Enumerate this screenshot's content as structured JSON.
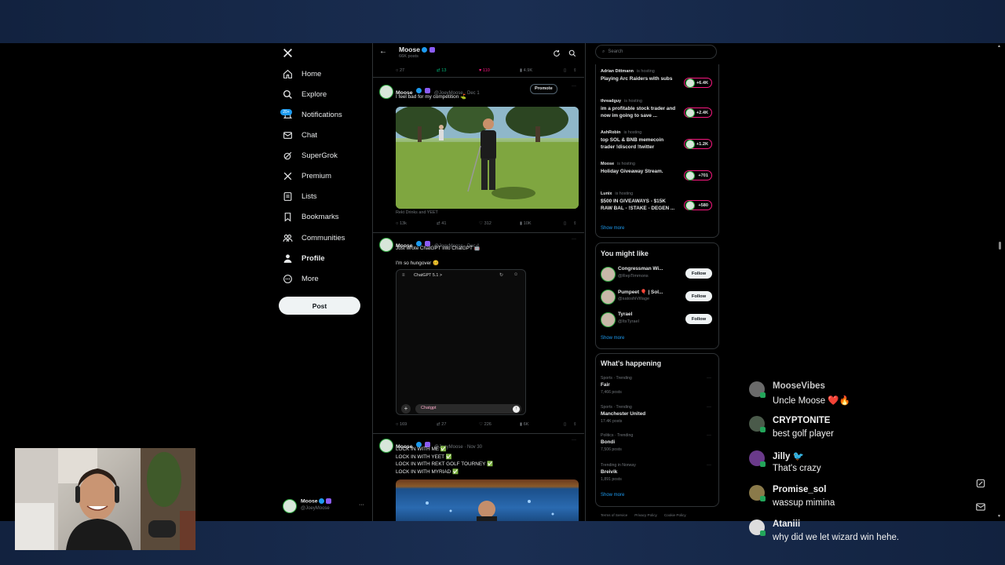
{
  "nav": {
    "items": [
      {
        "label": "Home",
        "icon": "home-icon"
      },
      {
        "label": "Explore",
        "icon": "search-icon"
      },
      {
        "label": "Notifications",
        "icon": "bell-icon",
        "badge": "20+"
      },
      {
        "label": "Chat",
        "icon": "mail-icon"
      },
      {
        "label": "SuperGrok",
        "icon": "grok-icon"
      },
      {
        "label": "Premium",
        "icon": "x-icon"
      },
      {
        "label": "Lists",
        "icon": "list-icon"
      },
      {
        "label": "Bookmarks",
        "icon": "bookmark-icon"
      },
      {
        "label": "Communities",
        "icon": "people-icon"
      },
      {
        "label": "Profile",
        "icon": "person-icon"
      },
      {
        "label": "More",
        "icon": "more-circle-icon"
      }
    ],
    "post_label": "Post",
    "account_name": "Moose",
    "account_handle": "@JoeyMoose"
  },
  "header": {
    "name": "Moose",
    "posts": "66K posts"
  },
  "top_actions": {
    "replies": "27",
    "reposts": "13",
    "likes": "110",
    "views": "4.9K"
  },
  "tweets": [
    {
      "name": "Moose",
      "handle": "@JoeyMoose · Dec 1",
      "text": "I feel bad for my competition ⛳",
      "promote": "Promote",
      "caption": "Rekt Drinks and YEET",
      "replies": "13k",
      "reposts": "41",
      "likes": "312",
      "views": "10K"
    },
    {
      "name": "Moose",
      "handle": "@JoeyMoose · Dec 1",
      "text": "Just wrote ChatGPT into ChatGPT 🤖\n\nI'm so hungover 🥴",
      "embed_title": "ChatGPT 5.1 >",
      "embed_input": "Chatgpt",
      "replies": "169",
      "reposts": "27",
      "likes": "226",
      "views": "6K"
    },
    {
      "name": "Moose",
      "handle": "@JoeyMoose · Nov 30",
      "text": "LOCK IN WITH ME ✅\nLOCK IN WITH YEET ✅\nLOCK IN WITH REKT GOLF TOURNEY ✅\nLOCK IN WITH MYRIAD ✅"
    }
  ],
  "search": {
    "placeholder": "Search"
  },
  "live": {
    "items": [
      {
        "host": "Adrian Dittmann",
        "status": "is hosting",
        "title": "Playing Arc Raiders with subs",
        "count": "+6.4K"
      },
      {
        "host": "threadguy",
        "status": "is hosting",
        "title": "im a profitable stock trader and now im going to save ...",
        "count": "+2.4K"
      },
      {
        "host": "AshRobin",
        "status": "is hosting",
        "title": "top SOL & BNB memecoin trader !discord !twitter",
        "count": "+1.2K"
      },
      {
        "host": "Moose",
        "status": "is hosting",
        "title": "Holiday Giveaway Stream.",
        "count": "+701"
      },
      {
        "host": "Lunix",
        "status": "is hosting",
        "title": "$500 IN GIVEAWAYS - $15K RAW BAL - !STAKE - DEGEN ...",
        "count": "+580"
      }
    ],
    "show_more": "Show more"
  },
  "might_like": {
    "title": "You might like",
    "follow_label": "Follow",
    "users": [
      {
        "name": "Congressman Wi...",
        "handle": "@RepTimmons"
      },
      {
        "name": "Pumpeet 🎈 | Sol...",
        "handle": "@satoshiVillage"
      },
      {
        "name": "Tyrael",
        "handle": "@ItsTyrael"
      }
    ],
    "show_more": "Show more"
  },
  "happening": {
    "title": "What's happening",
    "trends": [
      {
        "meta": "Sports · Trending",
        "name": "Fair",
        "posts": "7,466 posts"
      },
      {
        "meta": "Sports · Trending",
        "name": "Manchester United",
        "posts": "17.4K posts"
      },
      {
        "meta": "Politics · Trending",
        "name": "Bondi",
        "posts": "7,506 posts"
      },
      {
        "meta": "Trending in Norway",
        "name": "Breivik",
        "posts": "1,891 posts"
      }
    ],
    "show_more": "Show more"
  },
  "footer_links": [
    "Terms of Service",
    "Privacy Policy",
    "Cookie Policy"
  ],
  "chat": [
    {
      "user": "MooseVibes",
      "message": "Uncle Moose ❤️🔥"
    },
    {
      "user": "CRYPTONITE",
      "message": "best golf player"
    },
    {
      "user": "Jilly 🐦",
      "message": "That's crazy"
    },
    {
      "user": "Promise_sol",
      "message": "wassup mimina"
    },
    {
      "user": "Ataniii",
      "message": "why did we let wizard win hehe."
    }
  ],
  "colors": {
    "accent": "#1d9bf0",
    "live": "#f91880",
    "background": "#000000",
    "stream_band": "#12223f"
  }
}
